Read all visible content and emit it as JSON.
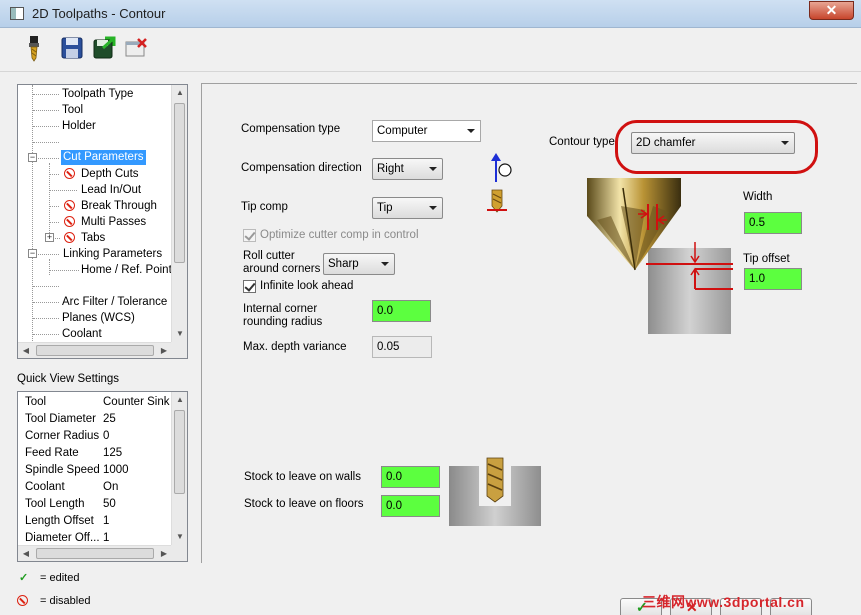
{
  "window": {
    "title": "2D Toolpaths - Contour",
    "close_label": "✕"
  },
  "toolbar": {
    "icons": [
      "tool-icon",
      "save-icon",
      "save-export-icon",
      "cancel-icon"
    ]
  },
  "tree": {
    "items": [
      {
        "label": "Toolpath Type"
      },
      {
        "label": "Tool"
      },
      {
        "label": "Holder"
      },
      {
        "label": ""
      },
      {
        "label": "Cut Parameters"
      },
      {
        "label": "Depth Cuts"
      },
      {
        "label": "Lead In/Out"
      },
      {
        "label": "Break Through"
      },
      {
        "label": "Multi Passes"
      },
      {
        "label": "Tabs"
      },
      {
        "label": "Linking Parameters"
      },
      {
        "label": "Home / Ref. Points"
      },
      {
        "label": ""
      },
      {
        "label": "Arc Filter / Tolerance"
      },
      {
        "label": "Planes (WCS)"
      },
      {
        "label": "Coolant"
      }
    ]
  },
  "quick_view": {
    "title": "Quick View Settings",
    "rows": [
      {
        "key": "Tool",
        "value": "Counter Sink -"
      },
      {
        "key": "Tool Diameter",
        "value": "25"
      },
      {
        "key": "Corner Radius",
        "value": "0"
      },
      {
        "key": "Feed Rate",
        "value": "125"
      },
      {
        "key": "Spindle Speed",
        "value": "1000"
      },
      {
        "key": "Coolant",
        "value": "On"
      },
      {
        "key": "Tool Length",
        "value": "50"
      },
      {
        "key": "Length Offset",
        "value": "1"
      },
      {
        "key": "Diameter Off...",
        "value": "1"
      }
    ]
  },
  "legend": {
    "edited": "= edited",
    "disabled": "= disabled"
  },
  "form": {
    "compensation_type_label": "Compensation type",
    "compensation_type_value": "Computer",
    "compensation_direction_label": "Compensation direction",
    "compensation_direction_value": "Right",
    "tip_comp_label": "Tip comp",
    "tip_comp_value": "Tip",
    "optimize_label": "Optimize cutter comp in control",
    "roll_cutter_label_1": "Roll cutter",
    "roll_cutter_label_2": "around corners",
    "roll_cutter_value": "Sharp",
    "infinite_look_label": "Infinite look ahead",
    "internal_corner_label_1": "Internal corner",
    "internal_corner_label_2": "rounding radius",
    "internal_corner_value": "0.0",
    "max_depth_label": "Max. depth variance",
    "max_depth_value": "0.05",
    "contour_type_label": "Contour type",
    "contour_type_value": "2D chamfer",
    "width_label": "Width",
    "width_value": "0.5",
    "tip_offset_label": "Tip offset",
    "tip_offset_value": "1.0",
    "stock_walls_label": "Stock to leave on walls",
    "stock_walls_value": "0.0",
    "stock_floors_label": "Stock to leave on floors",
    "stock_floors_value": "0.0"
  },
  "watermark": "三维网www.3dportal.cn",
  "colors": {
    "highlight_green": "#5cff3f",
    "annotation_red": "#d01010",
    "selection_blue": "#3399ff"
  }
}
